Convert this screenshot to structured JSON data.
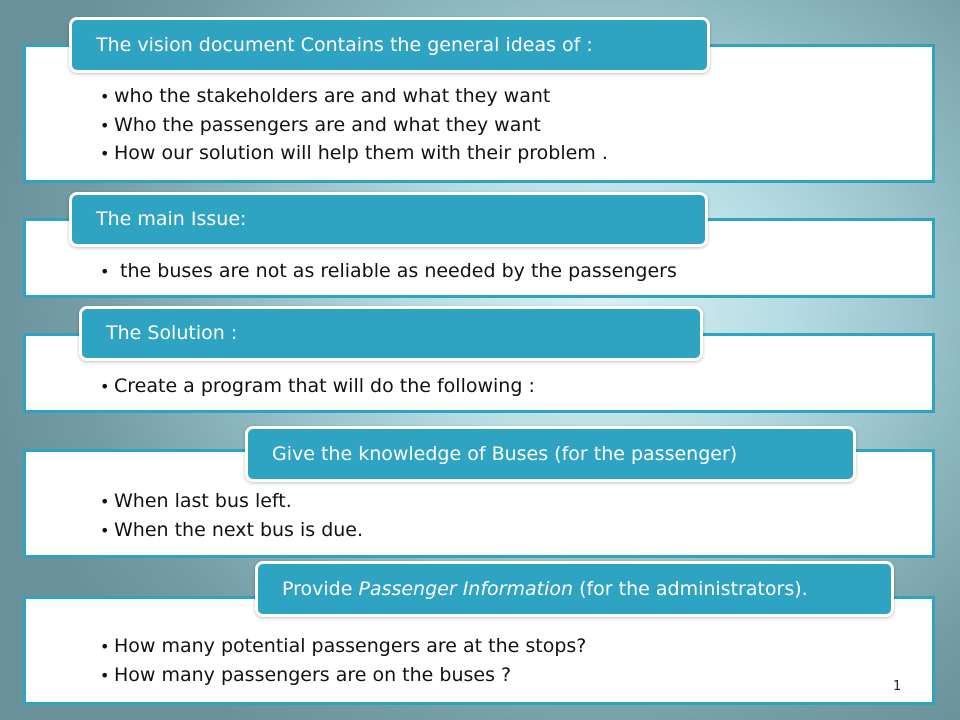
{
  "sections": [
    {
      "header": "The vision document  Contains the general ideas of :",
      "bullets": [
        "who the stakeholders are and what they want",
        "Who the passengers are and what they want",
        "How our solution will help them with their problem ."
      ]
    },
    {
      "header": "The main Issue:",
      "bullets": [
        " the buses are not as reliable as needed by the passengers"
      ]
    },
    {
      "header": "The Solution :",
      "bullets": [
        "Create a program that will do the following :"
      ]
    },
    {
      "header": "Give the knowledge of Buses (for the passenger)",
      "bullets": [
        "When last bus left.",
        "When the next bus is due."
      ]
    },
    {
      "header_prefix": "Provide ",
      "header_emphasis": "Passenger Information",
      "header_suffix": " (for the administrators).",
      "bullets": [
        "How many potential passengers are at the stops?",
        "How many passengers are on the buses ?"
      ]
    }
  ],
  "page_number": "1",
  "colors": {
    "accent": "#2ea3c2",
    "panel_bg": "#ffffff",
    "text": "#111111"
  }
}
